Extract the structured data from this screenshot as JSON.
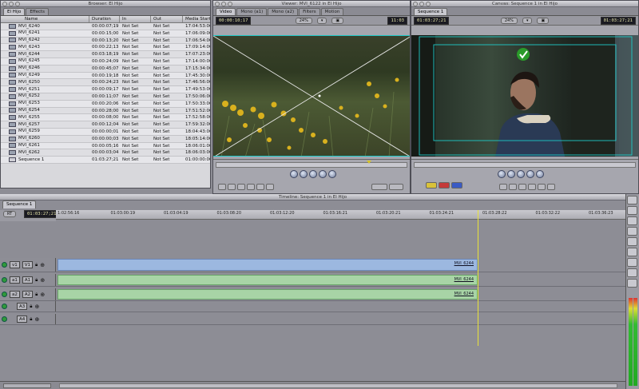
{
  "browser": {
    "title": "Browser: El Hijo",
    "tabs": [
      "El Hijo",
      "Effects"
    ],
    "columns": [
      "Name",
      "Duration",
      "In",
      "Out",
      "Media Start"
    ],
    "rows": [
      {
        "name": "MVI_6240",
        "duration": "00:00:07;19",
        "in": "Not Set",
        "out": "Not Set",
        "start": "17:04:53:06",
        "kind": "clip"
      },
      {
        "name": "MVI_6241",
        "duration": "00:00:15;00",
        "in": "Not Set",
        "out": "Not Set",
        "start": "17:06:09:00",
        "kind": "clip"
      },
      {
        "name": "MVI_6242",
        "duration": "00:00:13;20",
        "in": "Not Set",
        "out": "Not Set",
        "start": "17:06:54:00",
        "kind": "clip"
      },
      {
        "name": "MVI_6243",
        "duration": "00:00:22;13",
        "in": "Not Set",
        "out": "Not Set",
        "start": "17:09:14:00",
        "kind": "clip"
      },
      {
        "name": "MVI_6244",
        "duration": "00:03:18;19",
        "in": "Not Set",
        "out": "Not Set",
        "start": "17:07:23:00",
        "kind": "clip"
      },
      {
        "name": "MVI_6245",
        "duration": "00:00:24;09",
        "in": "Not Set",
        "out": "Not Set",
        "start": "17:14:00:00",
        "kind": "clip"
      },
      {
        "name": "MVI_6246",
        "duration": "00:00:45;07",
        "in": "Not Set",
        "out": "Not Set",
        "start": "17:15:34:00",
        "kind": "clip"
      },
      {
        "name": "MVI_6249",
        "duration": "00:00:19;18",
        "in": "Not Set",
        "out": "Not Set",
        "start": "17:45:30:00",
        "kind": "clip"
      },
      {
        "name": "MVI_6250",
        "duration": "00:00:24;23",
        "in": "Not Set",
        "out": "Not Set",
        "start": "17:46:56:00",
        "kind": "clip"
      },
      {
        "name": "MVI_6251",
        "duration": "00:00:09;17",
        "in": "Not Set",
        "out": "Not Set",
        "start": "17:49:53:00",
        "kind": "clip"
      },
      {
        "name": "MVI_6252",
        "duration": "00:00:11;07",
        "in": "Not Set",
        "out": "Not Set",
        "start": "17:50:06:00",
        "kind": "clip"
      },
      {
        "name": "MVI_6253",
        "duration": "00:00:20;06",
        "in": "Not Set",
        "out": "Not Set",
        "start": "17:50:33:00",
        "kind": "clip"
      },
      {
        "name": "MVI_6254",
        "duration": "00:00:28;00",
        "in": "Not Set",
        "out": "Not Set",
        "start": "17:51:52:00",
        "kind": "clip"
      },
      {
        "name": "MVI_6255",
        "duration": "00:00:08;00",
        "in": "Not Set",
        "out": "Not Set",
        "start": "17:52:58:00",
        "kind": "clip"
      },
      {
        "name": "MVI_6257",
        "duration": "00:00:12;04",
        "in": "Not Set",
        "out": "Not Set",
        "start": "17:59:32:00",
        "kind": "clip"
      },
      {
        "name": "MVI_6259",
        "duration": "00:00:00;01",
        "in": "Not Set",
        "out": "Not Set",
        "start": "18:04:43:00",
        "kind": "clip"
      },
      {
        "name": "MVI_6260",
        "duration": "00:00:00;03",
        "in": "Not Set",
        "out": "Not Set",
        "start": "18:05:14:00",
        "kind": "clip"
      },
      {
        "name": "MVI_6261",
        "duration": "00:00:05;16",
        "in": "Not Set",
        "out": "Not Set",
        "start": "18:06:01:00",
        "kind": "clip"
      },
      {
        "name": "MVI_6262",
        "duration": "00:00:03;04",
        "in": "Not Set",
        "out": "Not Set",
        "start": "18:06:03:00",
        "kind": "clip"
      },
      {
        "name": "Sequence 1",
        "duration": "01:03:27;21",
        "in": "Not Set",
        "out": "Not Set",
        "start": "01:00:00:00",
        "kind": "sequence"
      }
    ]
  },
  "viewer": {
    "title": "Viewer: MVI_6122 in El Hijo",
    "tabs": [
      "Video",
      "Mono (a1)",
      "Mono (a2)",
      "Filters",
      "Motion"
    ],
    "timecode": "00:00:10;17",
    "zoom": "24%",
    "timecode2": "11:03"
  },
  "canvas": {
    "title": "Canvas: Sequence 1 in El Hijo",
    "tabs": [
      "Sequence 1"
    ],
    "timecode": "01:03:27;21",
    "zoom": "24%",
    "timecode2": "01:03:27;21"
  },
  "timeline": {
    "title": "Timeline: Sequence 1 in El Hijo",
    "tab": "Sequence 1",
    "rt": "RT",
    "timecode": "01:03:27;21",
    "ruler": [
      "1:02:56:16",
      "01:03:00:19",
      "01:03:04:19",
      "01:03:08:20",
      "01:03:12:20",
      "01:03:16:21",
      "01:03:20:21",
      "01:03:24:21",
      "01:03:28:22",
      "01:03:32:22",
      "01:03:36:23"
    ],
    "tracks": [
      {
        "src": "v1",
        "dst": "V1",
        "kind": "video",
        "clip": "MVI_6244"
      },
      {
        "src": "a1",
        "dst": "A1",
        "kind": "audio",
        "clip": "MVI_6244"
      },
      {
        "src": "a2",
        "dst": "A2",
        "kind": "audio",
        "clip": "MVI_6244"
      },
      {
        "src": "",
        "dst": "A3",
        "kind": "empty",
        "clip": ""
      },
      {
        "src": "",
        "dst": "A4",
        "kind": "empty",
        "clip": ""
      }
    ]
  },
  "colors": {
    "video_clip": "#9cb8e0",
    "audio_clip": "#a8d4a6",
    "playhead": "#e9e23a",
    "overlay": "#1fc9c7"
  }
}
